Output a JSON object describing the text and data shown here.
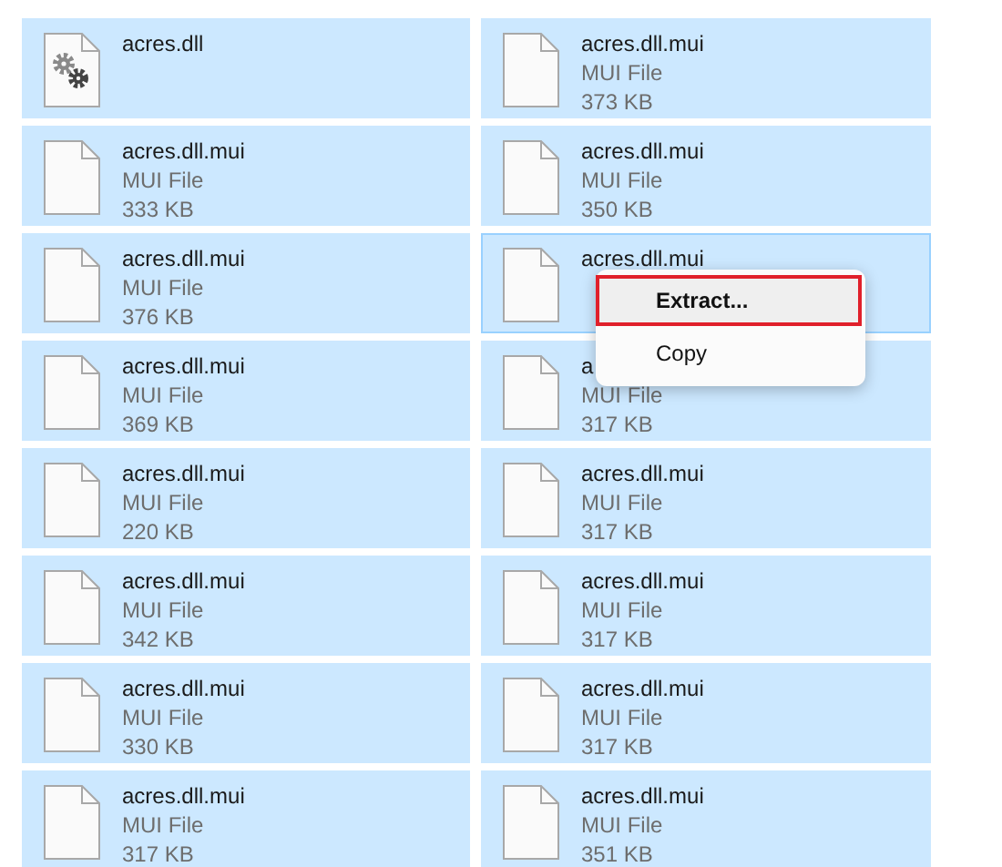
{
  "files": [
    {
      "kind": "dll",
      "name": "acres.dll",
      "hovered": false
    },
    {
      "kind": "mui",
      "name": "acres.dll.mui",
      "type": "MUI File",
      "size": "373 KB",
      "hovered": false
    },
    {
      "kind": "mui",
      "name": "acres.dll.mui",
      "type": "MUI File",
      "size": "333 KB",
      "hovered": false
    },
    {
      "kind": "mui",
      "name": "acres.dll.mui",
      "type": "MUI File",
      "size": "350 KB",
      "hovered": false
    },
    {
      "kind": "mui",
      "name": "acres.dll.mui",
      "type": "MUI File",
      "size": "376 KB",
      "hovered": false
    },
    {
      "kind": "mui",
      "name": "acres.dll.mui",
      "hovered": true
    },
    {
      "kind": "mui",
      "name": "acres.dll.mui",
      "type": "MUI File",
      "size": "369 KB",
      "hovered": false
    },
    {
      "kind": "mui",
      "name": "a",
      "type": "MUI File",
      "size": "317 KB",
      "hovered": false
    },
    {
      "kind": "mui",
      "name": "acres.dll.mui",
      "type": "MUI File",
      "size": "220 KB",
      "hovered": false
    },
    {
      "kind": "mui",
      "name": "acres.dll.mui",
      "type": "MUI File",
      "size": "317 KB",
      "hovered": false
    },
    {
      "kind": "mui",
      "name": "acres.dll.mui",
      "type": "MUI File",
      "size": "342 KB",
      "hovered": false
    },
    {
      "kind": "mui",
      "name": "acres.dll.mui",
      "type": "MUI File",
      "size": "317 KB",
      "hovered": false
    },
    {
      "kind": "mui",
      "name": "acres.dll.mui",
      "type": "MUI File",
      "size": "330 KB",
      "hovered": false
    },
    {
      "kind": "mui",
      "name": "acres.dll.mui",
      "type": "MUI File",
      "size": "317 KB",
      "hovered": false
    },
    {
      "kind": "mui",
      "name": "acres.dll.mui",
      "type": "MUI File",
      "size": "317 KB",
      "hovered": false
    },
    {
      "kind": "mui",
      "name": "acres.dll.mui",
      "type": "MUI File",
      "size": "351 KB",
      "hovered": false
    }
  ],
  "context_menu": [
    {
      "label": "Extract...",
      "highlighted": true
    },
    {
      "label": "Copy",
      "highlighted": false
    }
  ]
}
